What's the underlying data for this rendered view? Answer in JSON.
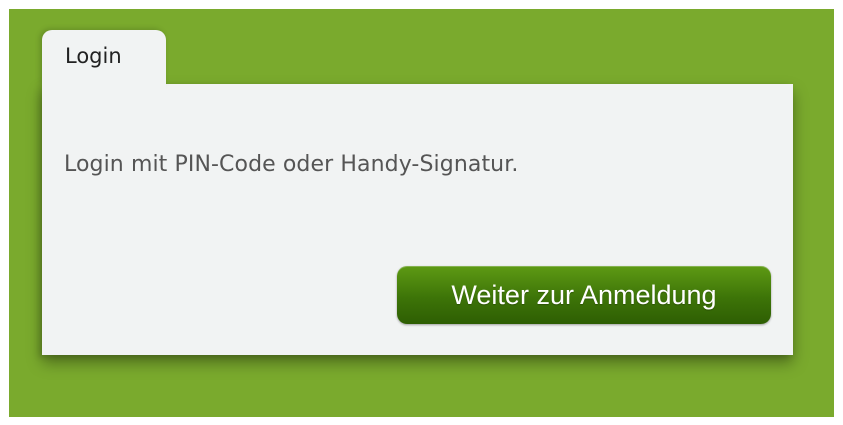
{
  "tab": {
    "label": "Login"
  },
  "panel": {
    "message": "Login mit PIN-Code oder Handy-Signatur.",
    "button_label": "Weiter zur Anmeldung"
  },
  "colors": {
    "background": "#7aaa2d",
    "panel": "#f1f3f3",
    "button": "#3d7408",
    "text": "#555555"
  }
}
